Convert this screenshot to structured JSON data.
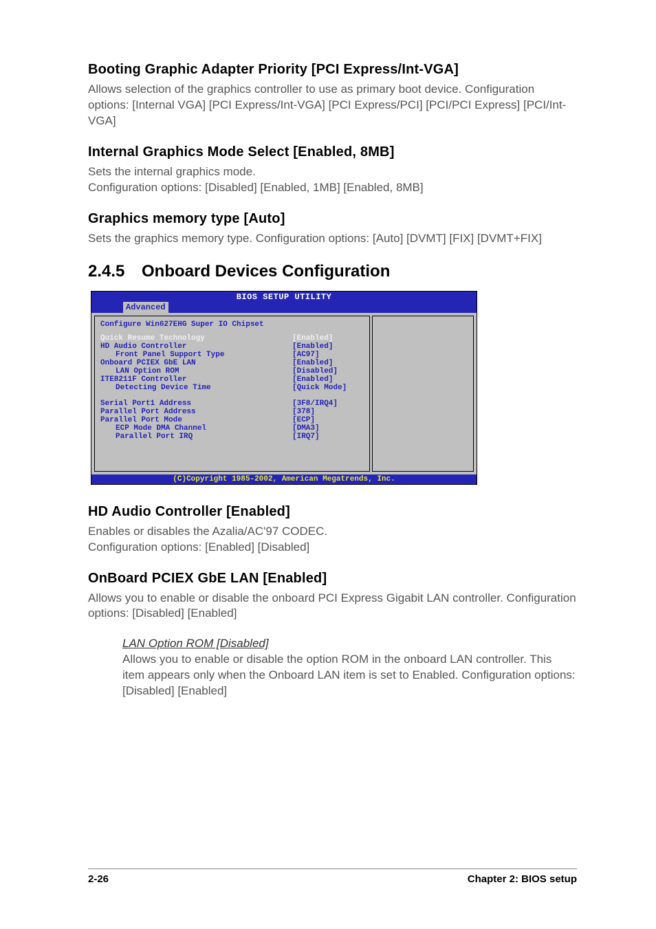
{
  "sections": {
    "s1": {
      "title": "Booting Graphic Adapter Priority [PCI Express/Int-VGA]",
      "body": "Allows selection of the graphics controller to use as primary boot device. Configuration options: [Internal VGA] [PCI Express/Int-VGA] [PCI Express/PCI] [PCI/PCI Express] [PCI/Int-VGA]"
    },
    "s2": {
      "title": "Internal Graphics Mode Select [Enabled, 8MB]",
      "body": "Sets the internal graphics mode.\nConfiguration options: [Disabled] [Enabled, 1MB] [Enabled, 8MB]"
    },
    "s3": {
      "title": "Graphics memory type [Auto]",
      "body": "Sets the graphics memory type. Configuration options: [Auto] [DVMT] [FIX] [DVMT+FIX]"
    },
    "h2": {
      "num": "2.4.5",
      "title": "Onboard Devices Configuration"
    },
    "s4": {
      "title": "HD Audio Controller [Enabled]",
      "body": "Enables or disables the Azalia/AC'97 CODEC.\nConfiguration options: [Enabled] [Disabled]"
    },
    "s5": {
      "title": "OnBoard PCIEX GbE LAN [Enabled]",
      "body": "Allows you to enable or disable the onboard PCI Express Gigabit LAN controller.  Configuration options: [Disabled] [Enabled]"
    },
    "sub1": {
      "title": "LAN Option ROM [Disabled]",
      "body": "Allows you to enable or disable the option ROM in the onboard LAN controller. This item appears only when the Onboard LAN item is set to Enabled. Configuration options: [Disabled] [Enabled]"
    }
  },
  "bios": {
    "title": "BIOS SETUP UTILITY",
    "tab": "Advanced",
    "heading": "Configure Win627EHG Super IO Chipset",
    "rows": [
      {
        "label": "Quick Resume Technology",
        "value": "[Enabled]",
        "selected": true
      },
      {
        "label": "HD Audio Controller",
        "value": "[Enabled]"
      },
      {
        "label": "Front Panel Support Type",
        "value": "[AC97]",
        "sub": true
      },
      {
        "label": "Onboard PCIEX GbE LAN",
        "value": "[Enabled]"
      },
      {
        "label": "LAN Option ROM",
        "value": "[Disabled]",
        "sub": true
      },
      {
        "label": "ITE8211F Controller",
        "value": "[Enabled]"
      },
      {
        "label": "Detecting Device Time",
        "value": "[Quick Mode]",
        "sub": true
      }
    ],
    "rows2": [
      {
        "label": "Serial Port1 Address",
        "value": "[3F8/IRQ4]"
      },
      {
        "label": "Parallel Port Address",
        "value": "[378]"
      },
      {
        "label": "Parallel Port Mode",
        "value": "[ECP]"
      },
      {
        "label": "ECP Mode DMA Channel",
        "value": "[DMA3]",
        "sub": true
      },
      {
        "label": "Parallel Port IRQ",
        "value": "[IRQ7]",
        "sub": true
      }
    ],
    "footer": "(C)Copyright 1985-2002, American Megatrends, Inc."
  },
  "footer": {
    "left": "2-26",
    "right": "Chapter 2: BIOS setup"
  }
}
